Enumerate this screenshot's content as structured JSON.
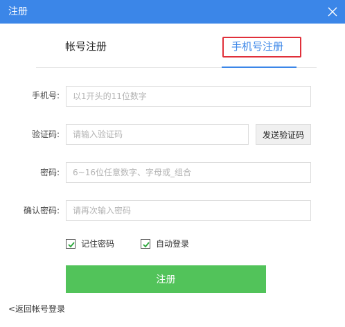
{
  "window": {
    "title": "注册",
    "close_icon": "close-icon"
  },
  "tabs": {
    "account_label": "帐号注册",
    "phone_label": "手机号注册",
    "accent_color": "#3b86e8",
    "highlight_color": "#e0303a"
  },
  "form": {
    "phone": {
      "label": "手机号:",
      "placeholder": "以1开头的11位数字",
      "value": ""
    },
    "code": {
      "label": "验证码:",
      "placeholder": "请输入验证码",
      "value": "",
      "send_label": "发送验证码"
    },
    "password": {
      "label": "密码:",
      "placeholder": "6~16位任意数字、字母或_组合",
      "value": ""
    },
    "confirm": {
      "label": "确认密码:",
      "placeholder": "请再次输入密码",
      "value": ""
    }
  },
  "options": {
    "remember": {
      "label": "记住密码",
      "checked": true
    },
    "auto_login": {
      "label": "自动登录",
      "checked": true
    }
  },
  "submit": {
    "label": "注册",
    "color": "#52c35a"
  },
  "back_link": {
    "label": "<返回帐号登录"
  }
}
